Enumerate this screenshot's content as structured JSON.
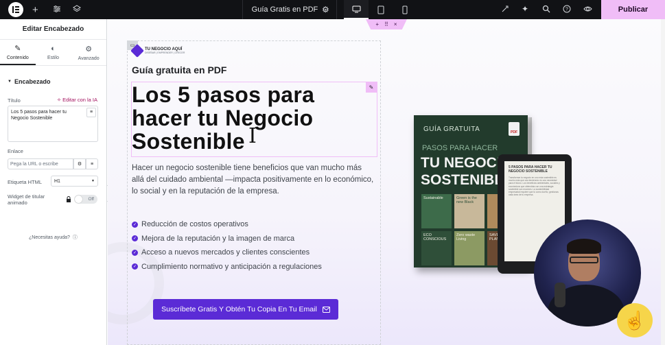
{
  "topbar": {
    "document_title": "Guía Gratis en PDF",
    "publish_label": "Publicar",
    "icons": [
      "elementor-logo-icon",
      "add-icon",
      "sliders-icon",
      "layers-icon",
      "chevron-down-icon",
      "settings-gear-icon",
      "desktop-icon",
      "tablet-icon",
      "mobile-icon",
      "rocket-icon",
      "ai-sparkle-icon",
      "search-icon",
      "help-icon",
      "eye-icon"
    ]
  },
  "panel": {
    "title": "Editar Encabezado",
    "tabs": [
      {
        "label": "Contenido",
        "icon": "pencil-icon",
        "active": true
      },
      {
        "label": "Estilo",
        "icon": "half-circle-icon",
        "active": false
      },
      {
        "label": "Avanzado",
        "icon": "gear-icon",
        "active": false
      }
    ],
    "section_label": "Encabezado",
    "title_label": "Título",
    "ai_link_label": "Editar con la IA",
    "title_value": "Los 5 pasos para hacer tu Negocio Sostenible",
    "link_label": "Enlace",
    "link_placeholder": "Pega la URL o escribe",
    "html_tag_label": "Etiqueta HTML",
    "html_tag_value": "H1",
    "animated_label": "Widget de titular animado",
    "animated_toggle": "Off",
    "help_label": "¿Necesitas ayuda?"
  },
  "page": {
    "brand_name": "TU NEGOCIO AQUÍ",
    "brand_tagline": "DISEÑAR | EMPRENDER | CRECER",
    "eyebrow": "Guía gratuita en PDF",
    "headline": "Los 5 pasos para hacer tu Negocio Sostenible",
    "paragraph": "Hacer un negocio sostenible tiene beneficios que van mucho más allá del cuidado ambiental —impacta positivamente en lo económico, lo social y en la reputación de la empresa.",
    "bullets": [
      "Reducción de costos operativos",
      "Mejora de la reputación y la imagen de marca",
      "Acceso a nuevos mercados y clientes conscientes",
      "Cumplimiento normativo y anticipación a regulaciones"
    ],
    "cta_label": "Suscríbete Gratis Y Obtén Tu Copia En Tu Email"
  },
  "book": {
    "label": "GUÍA GRATUITA",
    "line1": "PASOS PARA HACER",
    "line2a": "TU NEGOCIO",
    "line2b": "SOSTENIBLE",
    "pdf_badge": "PDF",
    "tiles": [
      "Sustainable",
      "Green is the new Black",
      "",
      "ECO CONSCIOUS",
      "Zero waste Living",
      "SAVE THE PLANET"
    ],
    "tile_colors": [
      "#3d6b4a",
      "#c8b89a",
      "#b08a5c",
      "#2f4f39",
      "#8c9a63",
      "#6b4a32"
    ]
  },
  "ereader": {
    "title": "5 PASOS PARA HACER TU NEGOCIO SOSTENIBLE",
    "text": "Transformar tu negocio en uno más sostenible es mucho más que una tendencia: es una necesidad para el futuro. Los beneficios ambientales, sociales y económicos que obtendrás con una estrategia sostenible son enormes. La sostenibilidad empresarial requiere que tú como dueño, gestionas cada área de tu empresa."
  },
  "colors": {
    "accent": "#5b2bd6",
    "editor_pink": "#f0bdf7",
    "topbar": "#111215"
  }
}
